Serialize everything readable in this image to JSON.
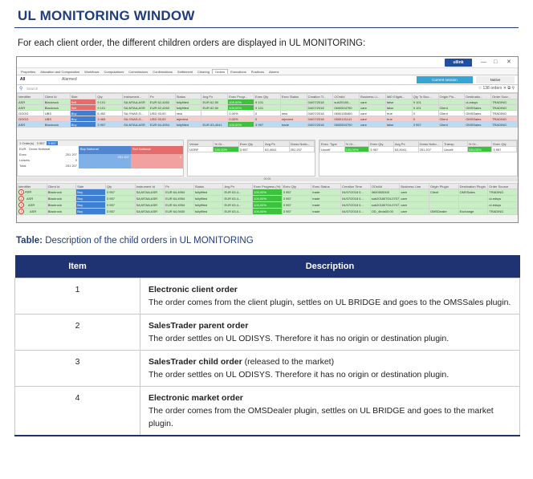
{
  "doc": {
    "title": "UL MONITORING WINDOW",
    "intro": "For each client order, the different children orders are displayed in UL MONITORING:"
  },
  "screenshot": {
    "brand": "ullink",
    "window_controls": [
      "—",
      "□",
      "✕"
    ],
    "menu": [
      "Properties",
      "Allocation and Computation",
      "Workflows",
      "Computations",
      "Commissions",
      "Confirmations",
      "Settlement",
      "Clearing",
      "Orders",
      "Executions",
      "Positions",
      "Alarms"
    ],
    "menu_active": "Orders",
    "tabs": {
      "all": "All",
      "alarmed": "Alarmed",
      "current_session": "Current session",
      "native": "Native"
    },
    "search_placeholder": "Search",
    "search_right": "☆ 138 orders  ✕  ⧉  ⚲",
    "top_headers": [
      "Identifier",
      "Client Id",
      "Side",
      "Qty",
      "Instrument...",
      "Px",
      "Status",
      "Avg Px",
      "Exec Progr...",
      "Exec Qty",
      "Exec Status",
      "Creation Ti...",
      "OOrdId",
      "Business Li...",
      "MiD Eligibl...",
      "Qty To Boo...",
      "Origin Plu...",
      "Destinatio...",
      "Order Sour..."
    ],
    "top_rows": [
      {
        "style": "green",
        "cells": [
          "ASR",
          "Blackrock",
          "Sell",
          "9 101",
          "SA;MTAA;ASR",
          "EUR 62,4260",
          "fullyfilled",
          "EUR 62,50",
          "100,00%",
          "9 101",
          "",
          "04/07/2018",
          "sub20180...",
          "care",
          "false",
          "9 101",
          "",
          "ul-edsys",
          "TRADING"
        ]
      },
      {
        "style": "green",
        "cells": [
          "ASR",
          "Blackrock",
          "Sell",
          "9 101",
          "SA;MTAA;ASR",
          "EUR 62,4260",
          "fullyfilled",
          "EUR 62,50",
          "100,00%",
          "9 101",
          "",
          "04/07/2018",
          "0600504790",
          "care",
          "false",
          "9 101",
          "Client",
          "OMSSales",
          "TRADING"
        ]
      },
      {
        "style": "white",
        "cells": [
          "GOOG",
          "UBS",
          "Buy",
          "6 452",
          "SA;YNAS;G...",
          "USD 93,00",
          "new",
          "",
          "0,00%",
          "0",
          "new",
          "04/07/2018",
          "0600155460",
          "care",
          "true",
          "0",
          "Client",
          "OMSSales",
          "TRADING"
        ]
      },
      {
        "style": "pink",
        "cells": [
          "GOOG",
          "UBS",
          "Buy",
          "3 465",
          "SA;YNAS;G...",
          "USD 93,00",
          "rejected",
          "",
          "0,00%",
          "0",
          "rejected",
          "04/07/2018",
          "0600141141",
          "care",
          "true",
          "0",
          "Client",
          "OMSSales",
          "TRADING"
        ]
      },
      {
        "style": "blue",
        "cells": [
          "ASR",
          "Blackrock",
          "Buy",
          "3 957",
          "SA;MTAA;ASR",
          "EUR 64,4954",
          "fullyfilled",
          "EUR 63,4041",
          "100,00%",
          "3 957",
          "trade",
          "04/07/2018",
          "0600504790",
          "care",
          "false",
          "3 957",
          "Client",
          "OMSSales",
          "TRADING"
        ]
      }
    ],
    "mid": {
      "order_label": "1 Order(s)",
      "order_qty": "3 957",
      "order_qty2": "3 957",
      "currency": "EUR",
      "gross_notional": "Gross Notional",
      "rows": [
        [
          "Exec",
          "251 207"
        ],
        [
          "Leaves",
          "0"
        ],
        [
          "Total",
          "251 207"
        ]
      ],
      "buy_label": "Buy Notional",
      "sell_label": "Sell Notional",
      "buy_value": "251 207",
      "sell_value": "0",
      "venue_headers": [
        "Venue",
        "% Gr...",
        "Exec Qty",
        "Avg Px",
        "Gross Notio..."
      ],
      "venue_row": [
        "UORF",
        "100,00%",
        "3 957",
        "63,4041",
        "251 207"
      ],
      "exec_headers": [
        "Exec. Type",
        "% Gr...",
        "Exec Qty",
        "Avg Px",
        "Gross Notio...",
        "Transp.",
        "% Gr...",
        "Exec Qty"
      ],
      "exec_row": [
        "Uncelf",
        "100,00%",
        "3 957",
        "63,4041",
        "251 207",
        "Uncelf",
        "100,00%",
        "3 957"
      ],
      "scroll_label": "00:00"
    },
    "child_headers": [
      "Identifier",
      "Client Id",
      "Side",
      "Qty",
      "Instrument Id",
      "Px",
      "Status",
      "Avg Px",
      "Exec Progress (%)",
      "Exec Qty",
      "Exec Status",
      "Creation Time",
      "OOrdId",
      "Business Line",
      "Origin Plugin",
      "Destination Plugin",
      "Order Source"
    ],
    "child_rows": [
      {
        "marker": "1",
        "cells": [
          "ASR",
          "Blackrock",
          "Buy",
          "3 957",
          "SA;MTAA;ASR",
          "EUR 64,4954",
          "fullyfilled",
          "EUR 63,4...",
          "100,00%",
          "3 957",
          "trade",
          "04/07/2018 0...",
          "0600505300",
          "care",
          "Client",
          "OMSSales",
          "TRADING"
        ]
      },
      {
        "marker": "2",
        "cells": [
          "ASR",
          "Blackrock",
          "Buy",
          "3 957",
          "SA;MTAA;ASR",
          "EUR 64,4954",
          "fullyfilled",
          "EUR 63,4...",
          "100,00%",
          "3 957",
          "trade",
          "04/07/2018 0...",
          "sub20180704-070746-300-01",
          "care",
          "",
          "",
          "ul-edsys"
        ]
      },
      {
        "marker": "3",
        "cells": [
          "ASR",
          "Blackrock",
          "Buy",
          "3 957",
          "SA;MTAA;ASR",
          "EUR 64,4954",
          "fullyfilled",
          "EUR 63,4...",
          "100,00%",
          "3 957",
          "trade",
          "04/07/2018 0...",
          "sub20180704-070755-387-00",
          "care",
          "",
          "",
          "ul-edsys"
        ]
      },
      {
        "marker": "4",
        "cells": [
          "ASR",
          "Blackrock",
          "Buy",
          "3 957",
          "SA;MTAA;ASR",
          "EUR 64,9400",
          "fullyfilled",
          "EUR 63,4...",
          "100,00%",
          "3 957",
          "trade",
          "04/07/2018 0...",
          "OD_4bda00:00",
          "care",
          "OMSDealer",
          "Exchange",
          "TRADING"
        ]
      }
    ]
  },
  "caption": {
    "prefix": "Table:",
    "text": " Description of the child orders in UL MONITORING"
  },
  "table": {
    "headers": {
      "item": "Item",
      "description": "Description"
    },
    "rows": [
      {
        "item": "1",
        "title": "Electronic client order",
        "title_suffix": "",
        "body": "The order comes from the client plugin, settles on UL BRIDGE and goes to the OMSSales plugin."
      },
      {
        "item": "2",
        "title": "SalesTrader parent order",
        "title_suffix": "",
        "body": "The order settles on UL ODISYS. Therefore it has no origin or destination plugin."
      },
      {
        "item": "3",
        "title": "SalesTrader child order",
        "title_suffix": " (released to the market)",
        "body": "The order settles on UL ODISYS. Therefore it has no origin or destination plugin."
      },
      {
        "item": "4",
        "title": "Electronic market order",
        "title_suffix": "",
        "body": "The order comes from the OMSDealer plugin, settles on UL BRIDGE and goes to the market plugin."
      }
    ]
  }
}
